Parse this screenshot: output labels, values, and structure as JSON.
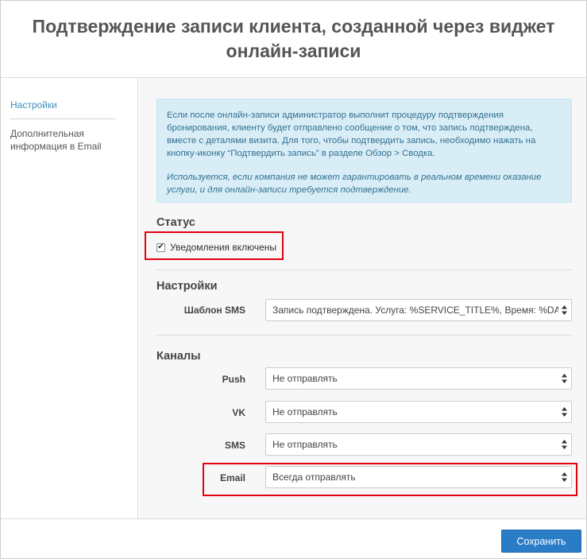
{
  "modal": {
    "title": "Подтверждение записи клиента, созданной через виджет онлайн-записи"
  },
  "sidebar": {
    "items": [
      {
        "label": "Настройки",
        "active": true
      },
      {
        "label": "Дополнительная информация в Email",
        "active": false
      }
    ]
  },
  "info": {
    "text": "Если после онлайн-записи администратор выполнит процедуру подтверждения бронирования, клиенту будет отправлено сообщение о том, что запись подтверждена, вместе с деталями визита. Для того, чтобы подтвердить запись, необходимо нажать на кнопку-иконку “Подтвердить запись” в разделе Обзор > Сводка.",
    "note": "Используется, если компания не может гарантировать в реальном времени оказание услуги, и для онлайн-записи требуется подтверждение."
  },
  "status": {
    "title": "Статус",
    "checkbox_label": "Уведомления включены",
    "checked": true
  },
  "settings": {
    "title": "Настройки",
    "sms_template_label": "Шаблон SMS",
    "sms_template_value": "Запись подтверждена. Услуга: %SERVICE_TITLE%, Время: %DATETIME%"
  },
  "channels": {
    "title": "Каналы",
    "rows": [
      {
        "label": "Push",
        "value": "Не отправлять"
      },
      {
        "label": "VK",
        "value": "Не отправлять"
      },
      {
        "label": "SMS",
        "value": "Не отправлять"
      },
      {
        "label": "Email",
        "value": "Всегда отправлять"
      }
    ]
  },
  "footer": {
    "save_label": "Сохранить"
  },
  "colors": {
    "accent": "#2a7cc7",
    "info_bg": "#d9edf7",
    "highlight": "#e3000f"
  }
}
